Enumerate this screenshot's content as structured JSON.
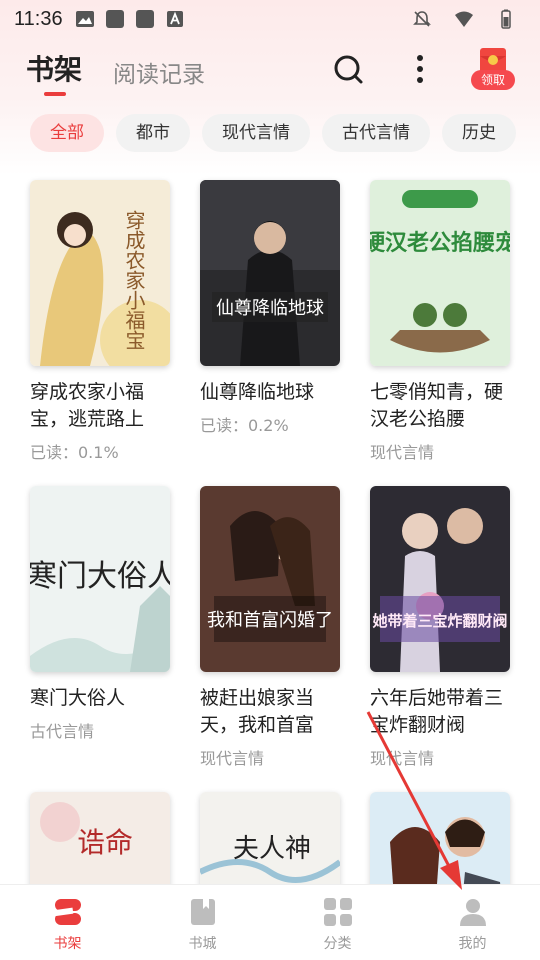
{
  "status_bar": {
    "time": "11:36"
  },
  "header": {
    "tab_shelf": "书架",
    "tab_history": "阅读记录",
    "reward_label": "领取"
  },
  "categories": [
    "全部",
    "都市",
    "现代言情",
    "古代言情",
    "历史"
  ],
  "books": [
    {
      "title": "穿成农家小福宝，逃荒路上",
      "meta": "已读：0.1%",
      "cover_text": "穿成农家小福宝"
    },
    {
      "title": "仙尊降临地球",
      "meta": "已读：0.2%",
      "cover_text": "仙尊降临地球"
    },
    {
      "title": "七零俏知青，硬汉老公掐腰",
      "meta": "现代言情",
      "cover_text": "硬汉老公掐腰宠"
    },
    {
      "title": "寒门大俗人",
      "meta": "古代言情",
      "cover_text": "寒门大俗人"
    },
    {
      "title": "被赶出娘家当天，我和首富",
      "meta": "现代言情",
      "cover_text": "我和首富闪婚了"
    },
    {
      "title": "六年后她带着三宝炸翻财阀",
      "meta": "现代言情",
      "cover_text": "她带着三宝炸翻财阀"
    },
    {
      "title": "",
      "meta": "",
      "cover_text": "诰命"
    },
    {
      "title": "",
      "meta": "",
      "cover_text": "夫人神"
    },
    {
      "title": "",
      "meta": "",
      "cover_text": ""
    }
  ],
  "bottom_nav": [
    {
      "label": "书架",
      "icon": "bookshelf-icon",
      "active": true
    },
    {
      "label": "书城",
      "icon": "book-store-icon",
      "active": false
    },
    {
      "label": "分类",
      "icon": "category-grid-icon",
      "active": false
    },
    {
      "label": "我的",
      "icon": "profile-icon",
      "active": false
    }
  ],
  "colors": {
    "accent": "#ea3d3d",
    "chip_bg": "#f2f2f2",
    "annotation_arrow": "#e53935"
  }
}
